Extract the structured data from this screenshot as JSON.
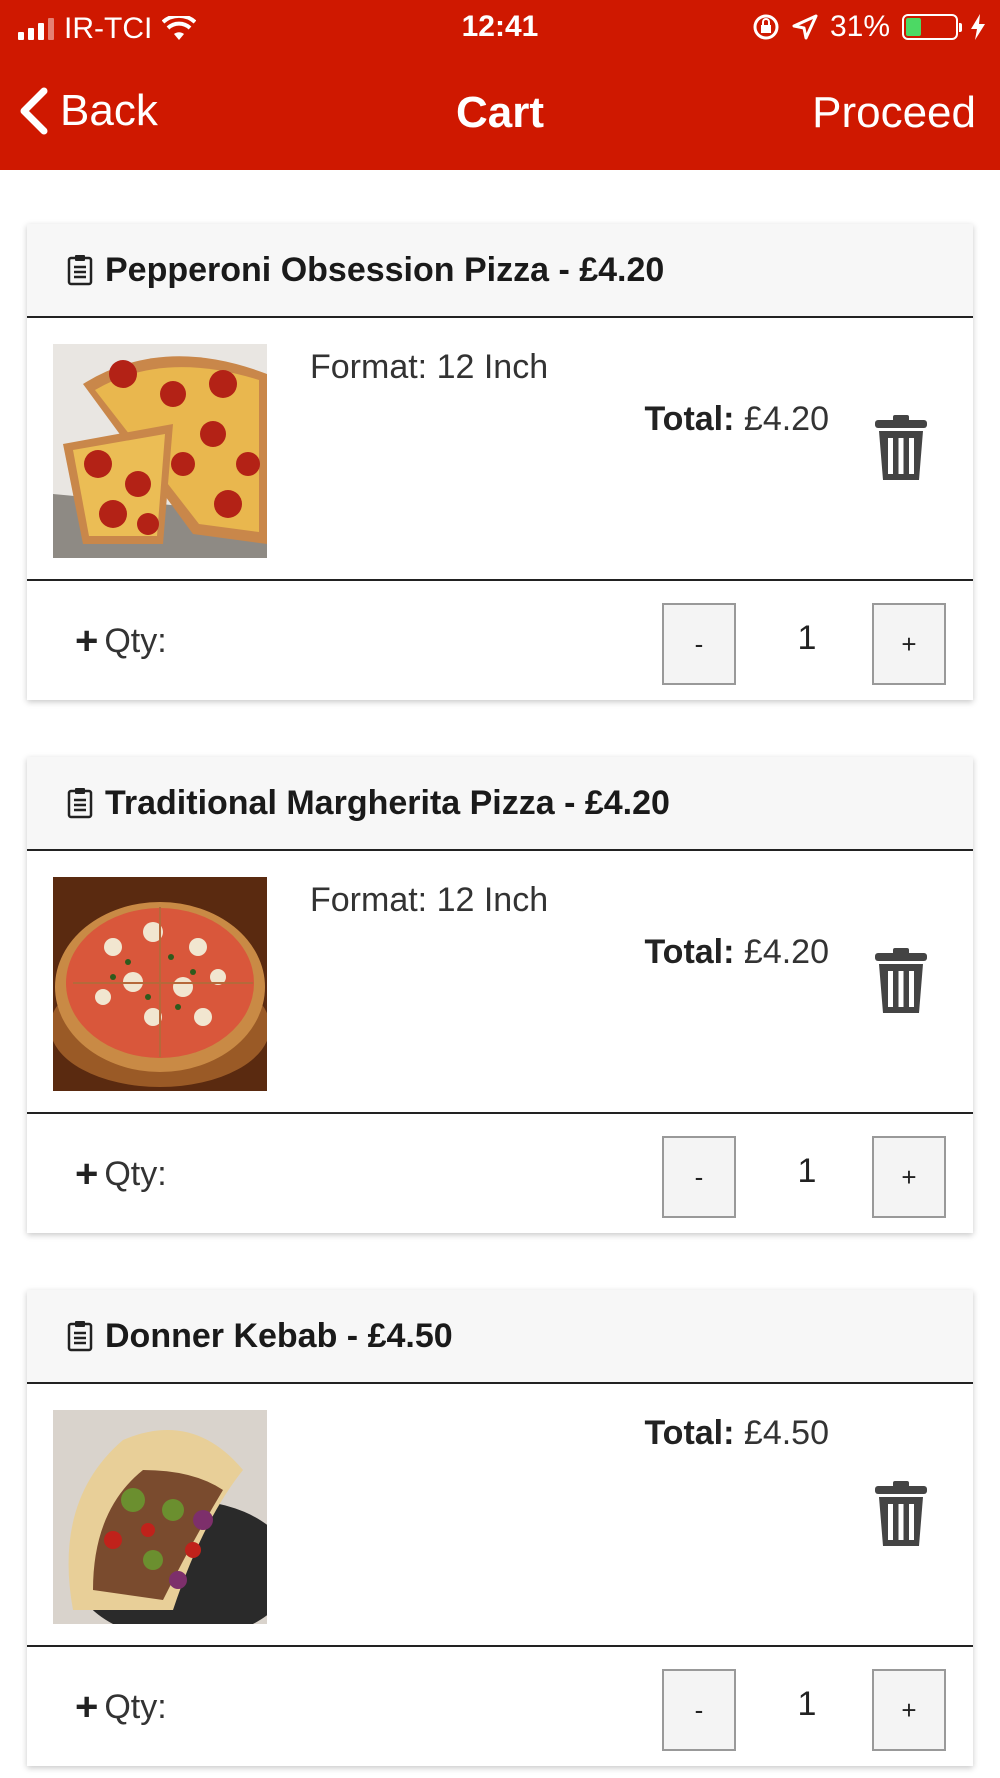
{
  "status_bar": {
    "carrier": "IR-TCI",
    "time": "12:41",
    "battery_percent": "31%",
    "battery_level": 0.31,
    "icons": [
      "signal-icon",
      "wifi-icon",
      "orientation-lock-icon",
      "location-arrow-icon",
      "battery-icon",
      "charging-bolt-icon"
    ]
  },
  "nav": {
    "back_label": "Back",
    "title": "Cart",
    "proceed_label": "Proceed"
  },
  "colors": {
    "accent": "#cf1800",
    "battery_fill": "#4cd964"
  },
  "cart": {
    "items": [
      {
        "heading": "Pepperoni Obsession Pizza - £4.20",
        "format": "Format: 12 Inch",
        "total_label": "Total:",
        "total_value": "£4.20",
        "qty_label": "Qty:",
        "minus": "-",
        "qty": "1",
        "plus": "+"
      },
      {
        "heading": "Traditional Margherita Pizza - £4.20",
        "format": "Format: 12 Inch",
        "total_label": "Total:",
        "total_value": "£4.20",
        "qty_label": "Qty:",
        "minus": "-",
        "qty": "1",
        "plus": "+"
      },
      {
        "heading": "Donner Kebab - £4.50",
        "format": "",
        "total_label": "Total:",
        "total_value": "£4.50",
        "qty_label": "Qty:",
        "minus": "-",
        "qty": "1",
        "plus": "+"
      }
    ]
  }
}
